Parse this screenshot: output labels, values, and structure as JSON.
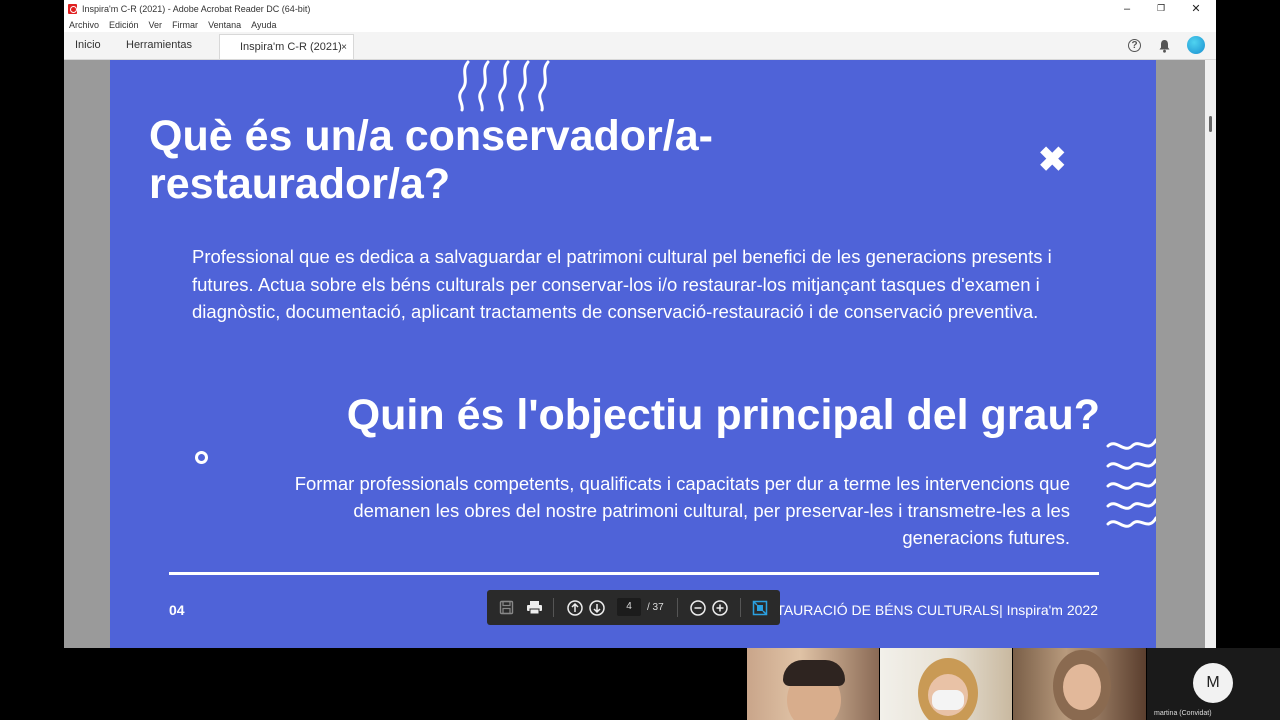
{
  "window": {
    "title": "Inspira'm C-R (2021) - Adobe Acrobat Reader DC (64-bit)",
    "minimize": "–",
    "restore": "❐",
    "close": "✕"
  },
  "menu": [
    "Archivo",
    "Edición",
    "Ver",
    "Firmar",
    "Ventana",
    "Ayuda"
  ],
  "tabs": {
    "home": "Inicio",
    "tools": "Herramientas",
    "document": "Inspira'm C-R (2021)",
    "close": "×"
  },
  "icons": {
    "help": "?",
    "bell": "bell-icon",
    "account": "account-avatar"
  },
  "slide": {
    "title1": "Què és un/a conservador/a-restaurador/a?",
    "body1": "Professional que es dedica a salvaguardar el patrimoni cultural pel benefici de les generacions presents i futures. Actua sobre els béns culturals per conservar-los i/o restaurar-los mitjançant tasques d'examen i diagnòstic, documentació, aplicant tractaments de conservació-restauració i de conservació preventiva.",
    "title2": "Quin és l'objectiu principal del grau?",
    "body2": "Formar professionals competents, qualificats i capacitats per dur a terme les intervencions que demanen les obres del nostre patrimoni cultural, per preservar-les i transmetre-les a les generacions futures.",
    "page_label": "04",
    "footer": "ESTAURACIÓ DE BÉNS CULTURALS| Inspira'm 2022",
    "xmark": "✖"
  },
  "toolbar": {
    "current_page": "4",
    "total": "/ 37"
  },
  "participants": {
    "guest_initial": "M",
    "guest_name": "martina (Convidat)"
  },
  "colors": {
    "slide_bg": "#4f63d8",
    "toolbar_bg": "#2a2a2a"
  }
}
